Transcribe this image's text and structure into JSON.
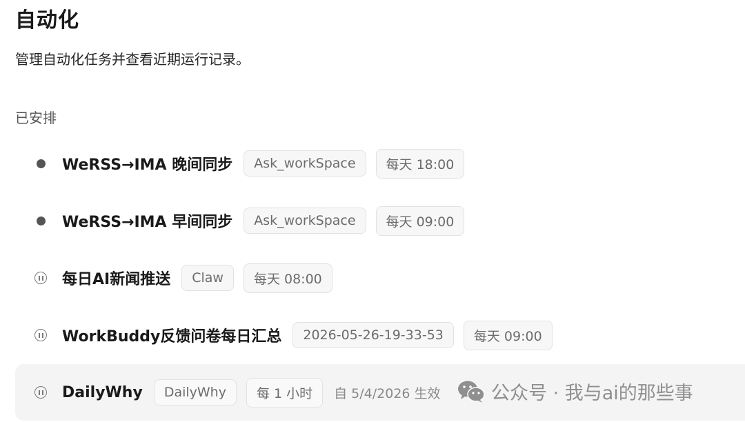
{
  "page": {
    "title": "自动化",
    "subtitle": "管理自动化任务并查看近期运行记录。",
    "section_label": "已安排"
  },
  "tasks": [
    {
      "name": "WeRSS→IMA 晚间同步",
      "status_icon": "running-dot-icon",
      "tags": [
        "Ask_workSpace",
        "每天 18:00"
      ]
    },
    {
      "name": "WeRSS→IMA 早间同步",
      "status_icon": "running-dot-icon",
      "tags": [
        "Ask_workSpace",
        "每天 09:00"
      ]
    },
    {
      "name": "每日AI新闻推送",
      "status_icon": "pause-icon",
      "tags": [
        "Claw",
        "每天 08:00"
      ]
    },
    {
      "name": "WorkBuddy反馈问卷每日汇总",
      "status_icon": "pause-icon",
      "tags": [
        "2026-05-26-19-33-53",
        "每天 09:00"
      ]
    },
    {
      "name": "DailyWhy",
      "status_icon": "pause-icon",
      "tags": [
        "DailyWhy",
        "每 1 小时"
      ],
      "effective": "自 5/4/2026 生效"
    }
  ],
  "watermark": {
    "text": "公众号 · 我与ai的那些事",
    "icon": "wechat-icon"
  },
  "colors": {
    "running_dot": "#555555",
    "highlight_row": "#f4f4f4",
    "tag_border": "#e2e2e2"
  }
}
